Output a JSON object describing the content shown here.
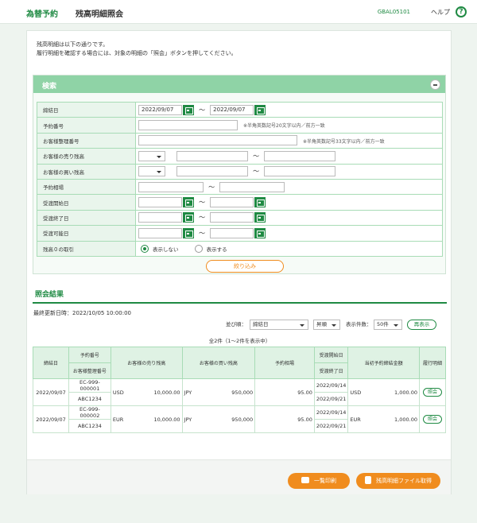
{
  "header": {
    "brand": "為替予約",
    "title": "残高明細照会",
    "screen_id": "GBAL05101",
    "help": "ヘルプ",
    "help_symbol": "?"
  },
  "intro": {
    "line1": "残高明細は以下の通りです。",
    "line2": "履行明細を確認する場合には、対象の明細の「照会」ボタンを押してください。"
  },
  "search": {
    "title": "検索",
    "rows": {
      "contract_date": {
        "label": "締結日",
        "from": "2022/09/07",
        "to": "2022/09/07"
      },
      "reservation_no": {
        "label": "予約番号",
        "note": "※半角英数記号20文字以内／前方一致"
      },
      "customer_ref": {
        "label": "お客様整理番号",
        "note": "※半角英数記号33文字以内／前方一致"
      },
      "sell_currency": {
        "label": "お客様の売り残高"
      },
      "buy_currency": {
        "label": "お客様の買い残高"
      },
      "rate": {
        "label": "予約相場"
      },
      "delivery_start": {
        "label": "受渡開始日"
      },
      "delivery_end": {
        "label": "受渡終了日"
      },
      "delivery_possible": {
        "label": "受渡可能日"
      },
      "zero_balance": {
        "label": "残高０の取引",
        "opt_hide": "表示しない",
        "opt_show": "表示する"
      }
    },
    "tilde": "～",
    "filter_button": "絞り込み"
  },
  "results": {
    "title": "照会結果",
    "updated": "最終更新日時：2022/10/05 10:00:00",
    "sort_label": "並び順：",
    "sort_value": "締結日",
    "order_value": "昇順",
    "page_size_label": "表示件数：",
    "page_size_value": "50件",
    "redisplay": "再表示",
    "count": "全2件（1～2件を表示中）",
    "columns": {
      "contract_date": "締結日",
      "reservation_no": "予約番号",
      "customer_ref": "お客様整理番号",
      "sell": "お客様の売り残高",
      "buy": "お客様の買い残高",
      "rate": "予約相場",
      "delivery_start": "受渡開始日",
      "delivery_end": "受渡終了日",
      "initial_amount": "当初予約締結金額",
      "detail": "履行明細"
    },
    "rows": [
      {
        "contract_date": "2022/09/07",
        "reservation_no": "EC-999-000001",
        "customer_ref": "ABC1234",
        "sell_ccy": "USD",
        "sell_amount": "10,000.00",
        "buy_ccy": "JPY",
        "buy_amount": "950,000",
        "rate": "95.00",
        "delivery_start": "2022/09/14",
        "delivery_end": "2022/09/21",
        "initial_ccy": "USD",
        "initial_amount": "1,000.00",
        "action": "照会"
      },
      {
        "contract_date": "2022/09/07",
        "reservation_no": "EC-999-000002",
        "customer_ref": "ABC1234",
        "sell_ccy": "EUR",
        "sell_amount": "10,000.00",
        "buy_ccy": "JPY",
        "buy_amount": "950,000",
        "rate": "95.00",
        "delivery_start": "2022/09/14",
        "delivery_end": "2022/09/21",
        "initial_ccy": "EUR",
        "initial_amount": "1,000.00",
        "action": "照会"
      }
    ]
  },
  "footer": {
    "print_button": "一覧印刷",
    "file_button": "残高明細ファイル取得"
  },
  "colors": {
    "brand_green": "#1f8a43",
    "search_header": "#8fd3a6",
    "accent_orange": "#f08c1e"
  }
}
